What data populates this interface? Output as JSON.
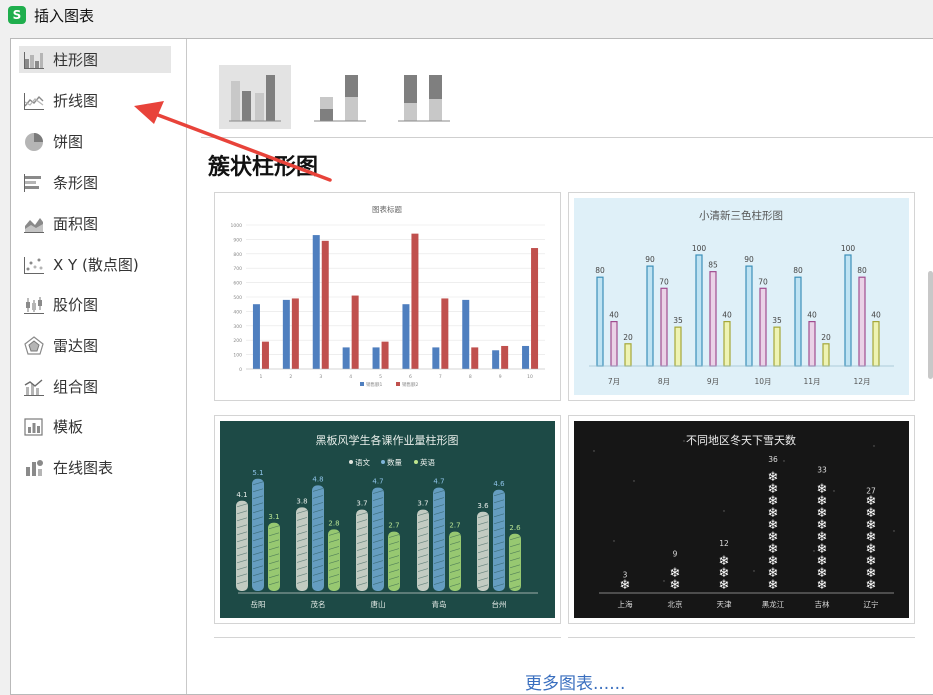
{
  "window": {
    "app_icon_letter": "S",
    "title": "插入图表"
  },
  "sidebar": {
    "items": [
      {
        "key": "column",
        "label": "柱形图",
        "icon": "column-chart-icon",
        "active": true
      },
      {
        "key": "line",
        "label": "折线图",
        "icon": "line-chart-icon",
        "active": false
      },
      {
        "key": "pie",
        "label": "饼图",
        "icon": "pie-chart-icon",
        "active": false
      },
      {
        "key": "bar",
        "label": "条形图",
        "icon": "bar-chart-icon",
        "active": false
      },
      {
        "key": "area",
        "label": "面积图",
        "icon": "area-chart-icon",
        "active": false
      },
      {
        "key": "scatter",
        "label": "X Y (散点图)",
        "icon": "scatter-chart-icon",
        "active": false
      },
      {
        "key": "stock",
        "label": "股价图",
        "icon": "stock-chart-icon",
        "active": false
      },
      {
        "key": "radar",
        "label": "雷达图",
        "icon": "radar-chart-icon",
        "active": false
      },
      {
        "key": "combo",
        "label": "组合图",
        "icon": "combo-chart-icon",
        "active": false
      },
      {
        "key": "template",
        "label": "模板",
        "icon": "template-icon",
        "active": false
      },
      {
        "key": "online",
        "label": "在线图表",
        "icon": "online-chart-icon",
        "active": false
      }
    ]
  },
  "main": {
    "subtypes": [
      "clustered-column-icon",
      "stacked-column-icon",
      "percent-stacked-column-icon"
    ],
    "section_title": "簇状柱形图",
    "more_label": "更多图表......"
  },
  "colors": {
    "accent_link": "#3a6fbf",
    "blue_series": "#4f7fbf",
    "red_series": "#c0504d",
    "annotation_arrow": "#e8433a"
  },
  "chart_data": [
    {
      "type": "bar",
      "title": "图表标题",
      "categories": [
        "1",
        "2",
        "3",
        "4",
        "5",
        "6",
        "7",
        "8",
        "9",
        "10"
      ],
      "series": [
        {
          "name": "销售额1",
          "values": [
            450,
            480,
            930,
            150,
            150,
            450,
            150,
            480,
            130,
            160
          ]
        },
        {
          "name": "销售额2",
          "values": [
            190,
            490,
            890,
            510,
            190,
            940,
            490,
            150,
            160,
            840
          ]
        }
      ],
      "yticks": [
        "0",
        "100",
        "200",
        "300",
        "400",
        "500",
        "600",
        "700",
        "800",
        "900",
        "1000"
      ],
      "ylim": [
        0,
        1000
      ],
      "legend": "bottom"
    },
    {
      "type": "bar",
      "title": "小清新三色柱形图",
      "categories": [
        "7月",
        "8月",
        "9月",
        "10月",
        "11月",
        "12月"
      ],
      "series": [
        {
          "values": [
            80,
            90,
            100,
            90,
            80,
            100
          ]
        },
        {
          "values": [
            40,
            70,
            85,
            70,
            40,
            80
          ]
        },
        {
          "values": [
            20,
            35,
            40,
            35,
            20,
            40
          ]
        }
      ],
      "ylim": [
        0,
        100
      ]
    },
    {
      "type": "bar",
      "title": "黑板风学生各课作业量柱形图",
      "legend_items": [
        "语文",
        "数量",
        "英语"
      ],
      "categories": [
        "岳阳",
        "茂名",
        "唐山",
        "青岛",
        "台州"
      ],
      "series": [
        {
          "values": [
            4.1,
            3.8,
            3.7,
            3.7,
            3.6
          ]
        },
        {
          "values": [
            5.1,
            4.8,
            4.7,
            4.7,
            4.6
          ]
        },
        {
          "values": [
            3.1,
            2.8,
            2.7,
            2.7,
            2.6
          ]
        }
      ],
      "legend": "top"
    },
    {
      "type": "bar",
      "title": "不同地区冬天下雪天数",
      "categories": [
        "上海",
        "北京",
        "天津",
        "黑龙江",
        "吉林",
        "辽宁"
      ],
      "values": [
        3,
        9,
        12,
        36,
        33,
        27
      ]
    }
  ]
}
